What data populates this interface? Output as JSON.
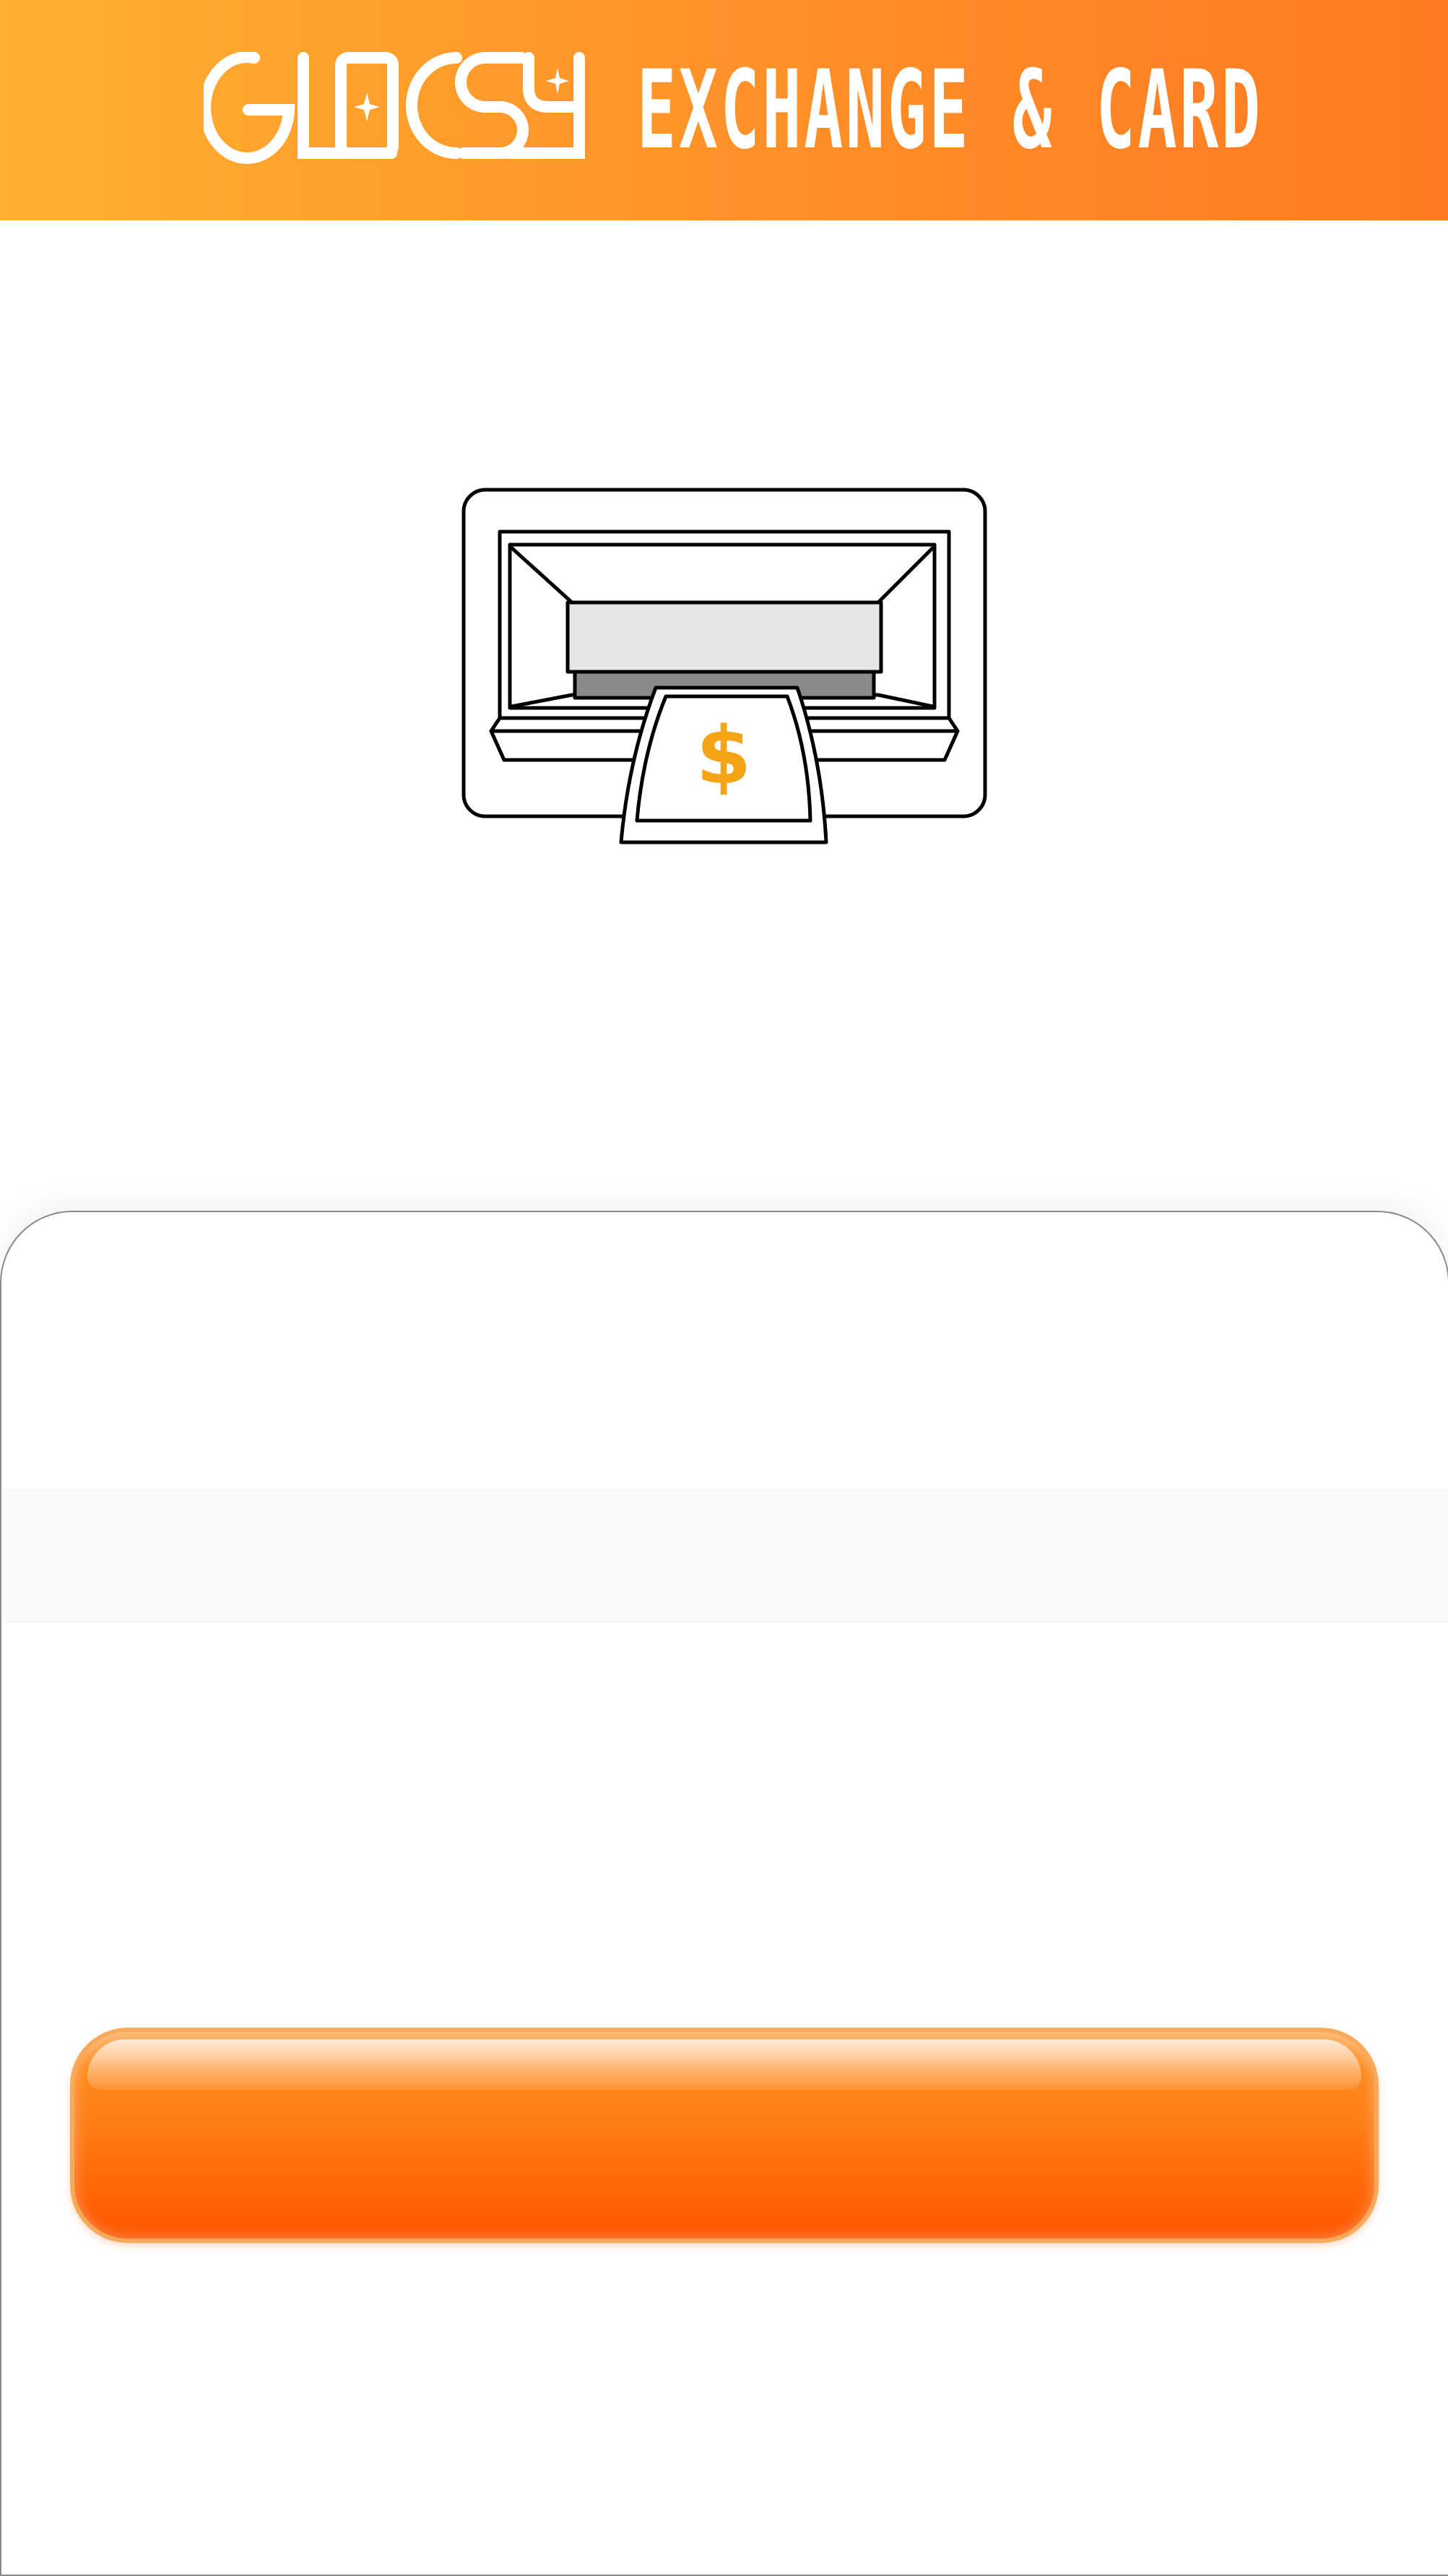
{
  "header": {
    "brand": "GLOCSY",
    "tagline": "EXCHANGE & CARD",
    "gradient_start": "#ffb030",
    "gradient_end": "#ff7a22"
  },
  "hero": {
    "icon": "atm-cash-icon",
    "currency_symbol": "$",
    "currency_color": "#f5a416"
  },
  "action": {
    "button_label": "",
    "button_color": "#ff7a12"
  }
}
